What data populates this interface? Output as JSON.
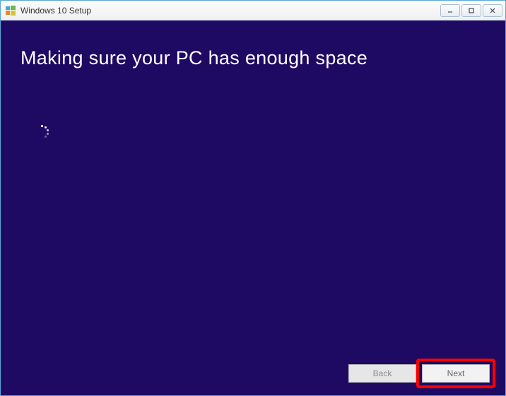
{
  "window": {
    "title": "Windows 10 Setup"
  },
  "content": {
    "heading": "Making sure your PC has enough space"
  },
  "buttons": {
    "back": "Back",
    "next": "Next"
  },
  "colors": {
    "background": "#1f0a63",
    "highlight": "#ff0000"
  }
}
